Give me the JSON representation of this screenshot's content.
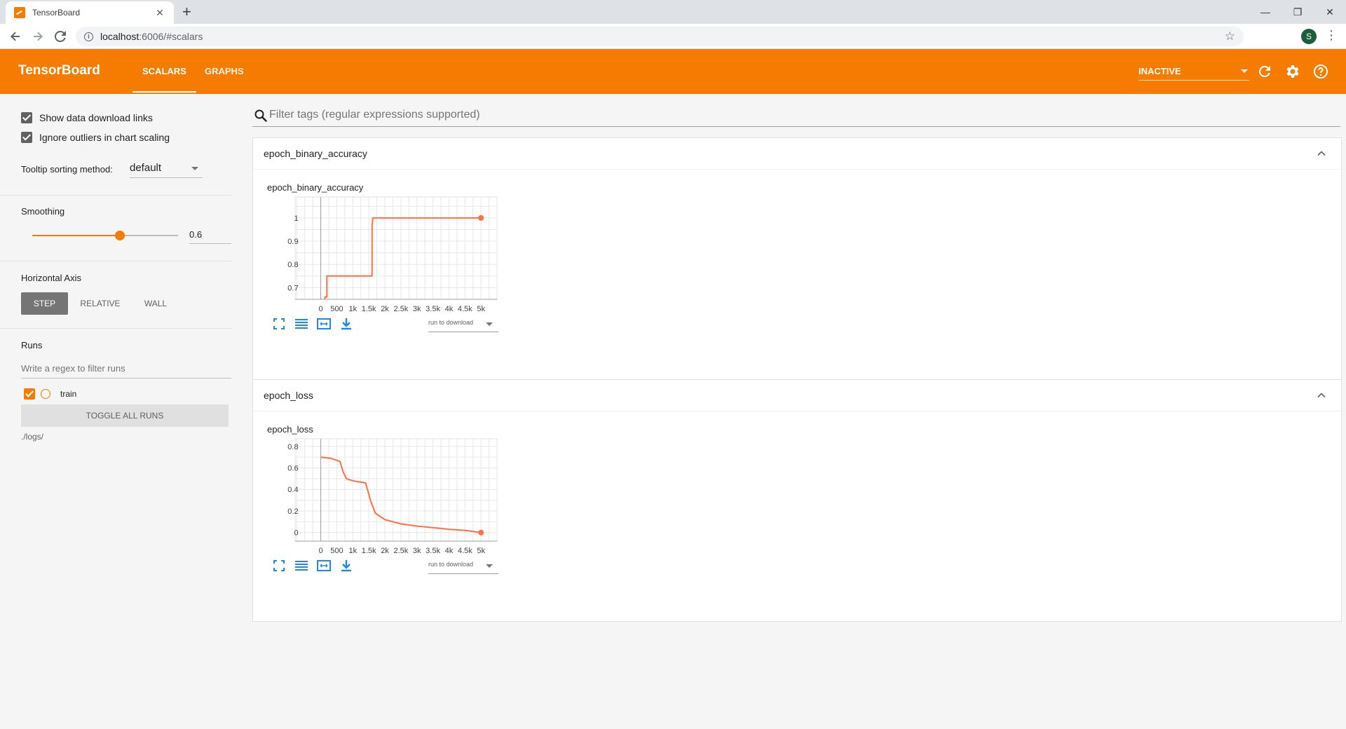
{
  "browser": {
    "tab_title": "TensorBoard",
    "tab_close": "✕",
    "new_tab": "+",
    "url_host": "localhost",
    "url_path": ":6006/#scalars",
    "profile_initial": "S",
    "win_minimize": "—",
    "win_restore": "❐",
    "win_close": "✕"
  },
  "header": {
    "brand": "TensorBoard",
    "tabs": [
      {
        "label": "SCALARS",
        "active": true
      },
      {
        "label": "GRAPHS",
        "active": false
      }
    ],
    "run_status": "INACTIVE"
  },
  "sidebar": {
    "show_download_links": {
      "label": "Show data download links",
      "checked": true
    },
    "ignore_outliers": {
      "label": "Ignore outliers in chart scaling",
      "checked": true
    },
    "tooltip_sorting": {
      "label": "Tooltip sorting method:",
      "value": "default"
    },
    "smoothing": {
      "label": "Smoothing",
      "value": 0.6,
      "value_text": "0.6"
    },
    "horizontal_axis": {
      "label": "Horizontal Axis",
      "options": [
        {
          "label": "STEP",
          "active": true
        },
        {
          "label": "RELATIVE",
          "active": false
        },
        {
          "label": "WALL",
          "active": false
        }
      ]
    },
    "runs": {
      "label": "Runs",
      "filter_placeholder": "Write a regex to filter runs",
      "items": [
        {
          "name": "train",
          "checked": true,
          "color": "#f57c00"
        }
      ],
      "toggle_all_label": "TOGGLE ALL RUNS",
      "logdir": "./logs/"
    }
  },
  "main": {
    "filter_placeholder": "Filter tags (regular expressions supported)",
    "download_select_label": "run to download",
    "cards": [
      {
        "group": "epoch_binary_accuracy",
        "chart_title": "epoch_binary_accuracy"
      },
      {
        "group": "epoch_loss",
        "chart_title": "epoch_loss"
      }
    ]
  },
  "colors": {
    "accent": "#f57c00",
    "series_line": "#ff7043",
    "tool_icon": "#1e88e5"
  },
  "chart_data": [
    {
      "type": "line",
      "title": "epoch_binary_accuracy",
      "xlabel": "",
      "ylabel": "",
      "x_ticks": [
        "0",
        "500",
        "1k",
        "1.5k",
        "2k",
        "2.5k",
        "3k",
        "3.5k",
        "4k",
        "4.5k",
        "5k"
      ],
      "y_ticks": [
        "0.7",
        "0.8",
        "0.9",
        "1"
      ],
      "xlim": [
        -800,
        5500
      ],
      "ylim": [
        0.65,
        1.09
      ],
      "grid": true,
      "series": [
        {
          "x": [
            130,
            130,
            190,
            190,
            300,
            600,
            900,
            1200,
            1600,
            1600,
            1620,
            1620,
            2000,
            3000,
            4000,
            5000
          ],
          "y": [
            0.62,
            0.66,
            0.66,
            0.75,
            0.75,
            0.75,
            0.75,
            0.75,
            0.75,
            0.97,
            0.99,
            1.0,
            1.0,
            1.0,
            1.0,
            1.0
          ]
        }
      ],
      "endpoint": {
        "x": 5000,
        "y": 1.0
      }
    },
    {
      "type": "line",
      "title": "epoch_loss",
      "xlabel": "",
      "ylabel": "",
      "x_ticks": [
        "0",
        "500",
        "1k",
        "1.5k",
        "2k",
        "2.5k",
        "3k",
        "3.5k",
        "4k",
        "4.5k",
        "5k"
      ],
      "y_ticks": [
        "0",
        "0.2",
        "0.4",
        "0.6",
        "0.8"
      ],
      "xlim": [
        -800,
        5500
      ],
      "ylim": [
        -0.08,
        0.87
      ],
      "grid": true,
      "series": [
        {
          "x": [
            0,
            300,
            600,
            700,
            800,
            1000,
            1400,
            1550,
            1700,
            2000,
            2500,
            3000,
            3500,
            4000,
            4500,
            5000
          ],
          "y": [
            0.7,
            0.69,
            0.66,
            0.56,
            0.5,
            0.48,
            0.46,
            0.3,
            0.18,
            0.12,
            0.08,
            0.06,
            0.045,
            0.03,
            0.02,
            0.0
          ]
        }
      ],
      "endpoint": {
        "x": 5000,
        "y": 0.0
      }
    }
  ]
}
